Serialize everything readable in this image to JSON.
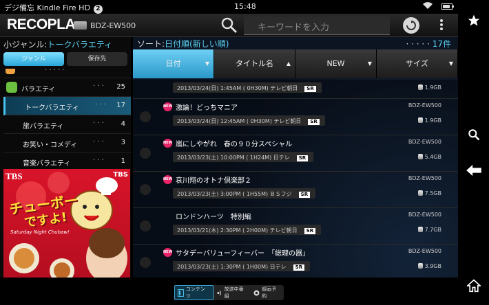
{
  "statusbar": {
    "title": "デジ備忘 Kindle Fire HD",
    "notification_count": "2",
    "time": "15:48"
  },
  "header": {
    "logo": "RECOPLA",
    "device": "BDZ-EW500",
    "search_placeholder": "キーワードを入力"
  },
  "left": {
    "subgenre_prefix": "小ジャンル:",
    "subgenre_value": "トークバラエティ",
    "tabs": [
      {
        "label": "ジャンル",
        "active": true
      },
      {
        "label": "保存先",
        "active": false
      }
    ],
    "top_dots": "· · · · ·",
    "genres": [
      {
        "name": "バラエティ",
        "dots": "· · ·",
        "count": "25",
        "type": "cat"
      },
      {
        "name": "トークバラエティ",
        "dots": "· · ·",
        "count": "17",
        "type": "sub",
        "selected": true
      },
      {
        "name": "旅バラエティ",
        "dots": "· · ·",
        "count": "4",
        "type": "sub"
      },
      {
        "name": "お笑い・コメディ",
        "dots": "· · ·",
        "count": "3",
        "type": "sub"
      },
      {
        "name": "音楽バラエティ",
        "dots": "· · ·",
        "count": "1",
        "type": "sub"
      }
    ],
    "banner": {
      "network": "TBS",
      "network2": "TBS",
      "title1": "チューボー",
      "title2": "ですよ!",
      "subtitle": "Saturday Night Chubaw!"
    }
  },
  "main": {
    "sort_prefix": "ソート:",
    "sort_value": "日付順(新しい順)",
    "count_dots": "· · · · ·",
    "count": "17件",
    "columns": [
      {
        "label": "日付",
        "arrow": "▼",
        "active": true
      },
      {
        "label": "タイトル名",
        "arrow": "▲",
        "active": false
      },
      {
        "label": "NEW",
        "arrow": "▼",
        "active": false
      },
      {
        "label": "サイズ",
        "arrow": "▼",
        "active": false
      }
    ],
    "partial_row": {
      "info": "2013/03/24(日) 1:45AM ( 0H30M) テレビ朝日",
      "sr": "SR",
      "size": "1.9GB"
    },
    "rows": [
      {
        "new": "NEW",
        "title": "激論！どっちマニア",
        "device": "BDZ-EW500",
        "info": "2013/03/24(日) 12:45AM ( 0H30M) テレビ朝日",
        "sr": "SR",
        "size": "1.9GB"
      },
      {
        "new": "NEW",
        "title": "嵐にしやがれ　春の９０分スペシャル",
        "device": "BDZ-EW500",
        "info": "2013/03/23(土) 10:00PM ( 1H24M) 日テレ",
        "sr": "SR",
        "size": "5.4GB"
      },
      {
        "new": "NEW",
        "title": "哀川翔のオトナ倶楽部２",
        "device": "BDZ-EW500",
        "info": "2013/03/23(土) 3:00PM ( 1H55M) ＢＳフジ",
        "sr": "SR",
        "size": "7.5GB"
      },
      {
        "new": "",
        "title": "ロンドンハーツ　特別編",
        "device": "BDZ-EW500",
        "info": "2013/03/21(木) 2:30PM ( 2H00M) テレビ朝日",
        "sr": "SR",
        "size": "7.7GB"
      },
      {
        "new": "NEW",
        "title": "サタデーバリューフィーバー　「総理の器」",
        "device": "BDZ-EW500",
        "info": "2013/03/23(土) 1:30PM ( 1H00M) 日テレ",
        "sr": "SR",
        "size": "3.9GB"
      }
    ]
  },
  "bottombar": {
    "contents": "コンテンツ",
    "broadcasting": "放送中番組",
    "reservation": "録画予約"
  }
}
